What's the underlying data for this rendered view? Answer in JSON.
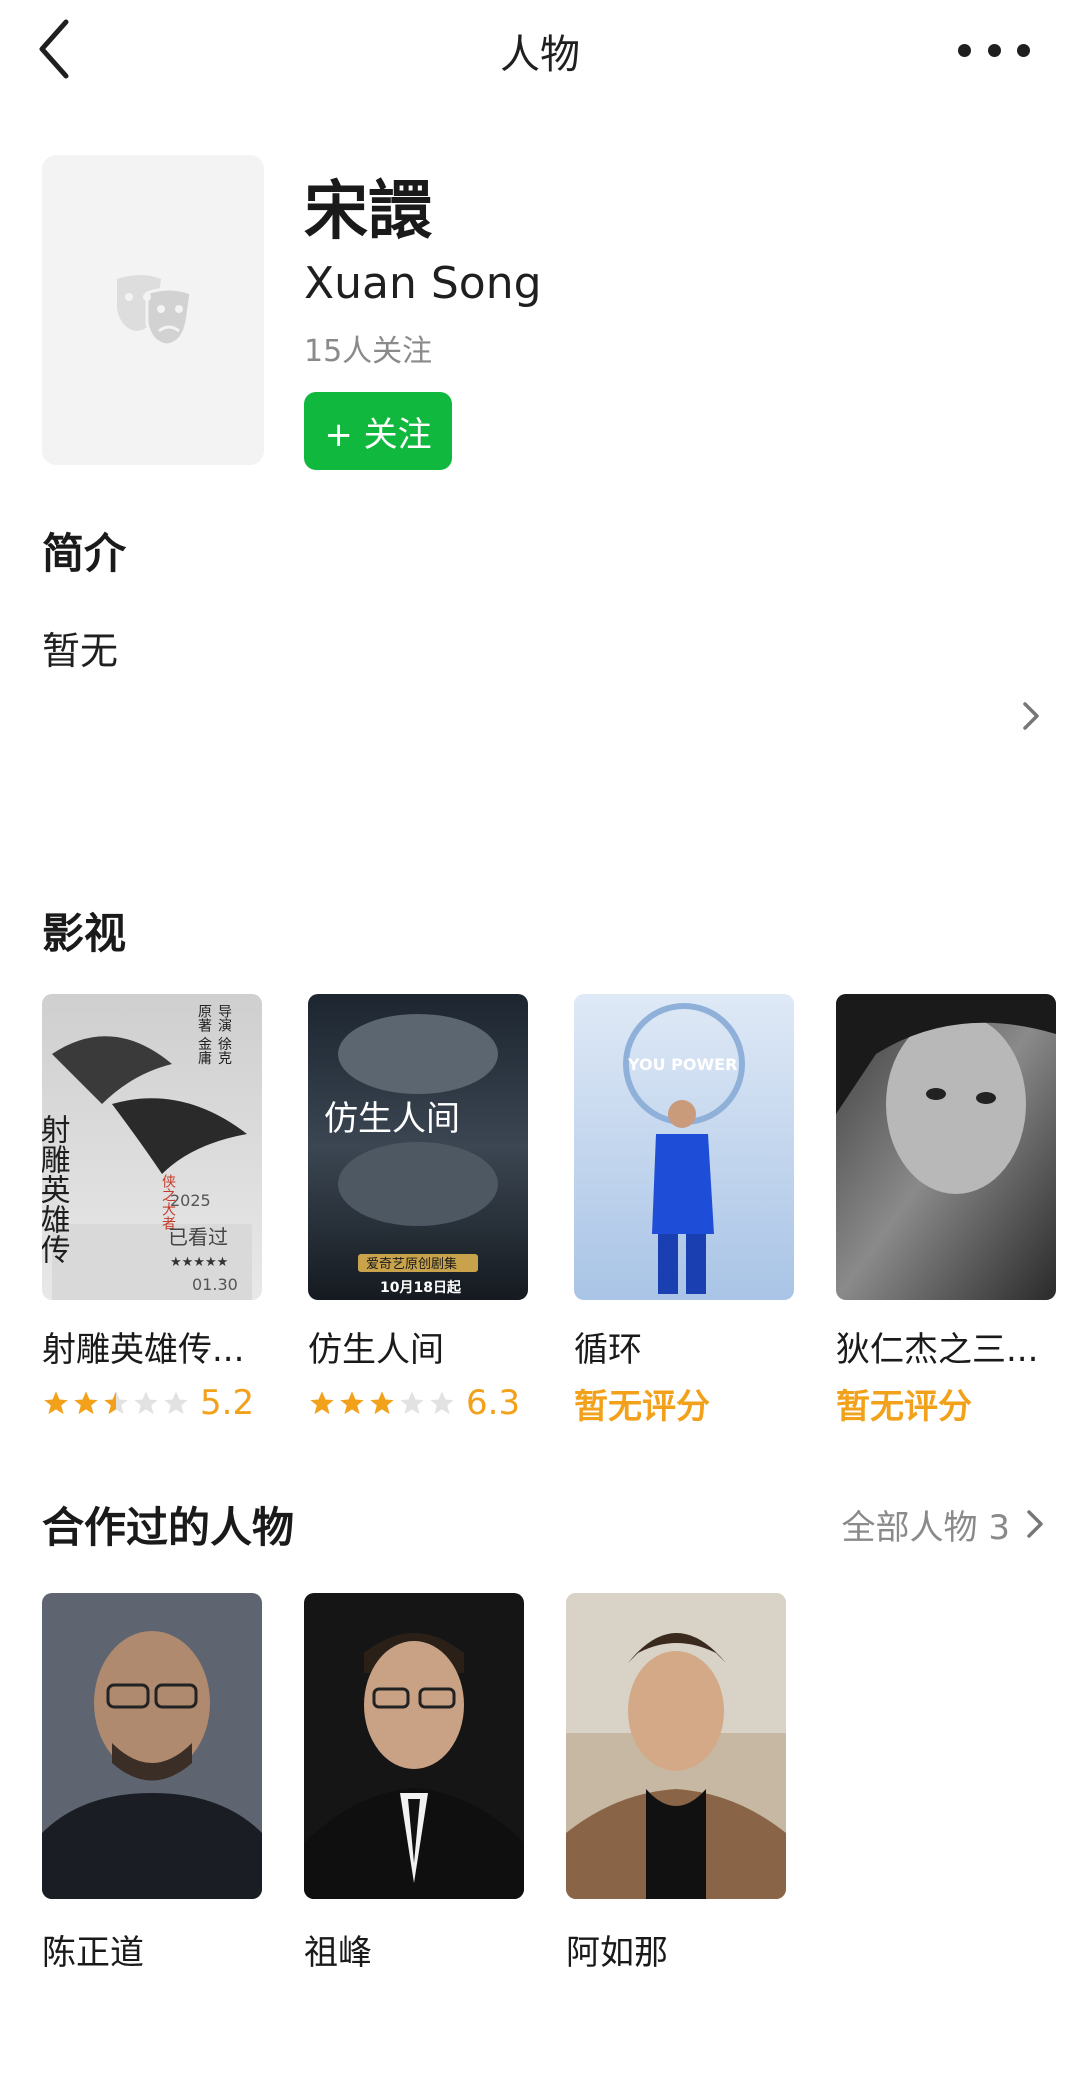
{
  "header": {
    "title": "人物"
  },
  "profile": {
    "name_cn": "宋譞",
    "name_en": "Xuan Song",
    "followers": "15人关注",
    "follow_label": "+ 关注"
  },
  "intro": {
    "title": "简介",
    "text": "暂无"
  },
  "works": {
    "title": "影视",
    "items": [
      {
        "title": "射雕英雄传...",
        "stars": 2.5,
        "score": "5.2",
        "rated": true,
        "poster_text": [
          "射雕英雄传",
          "侠之大者",
          "已看过",
          "2025",
          "01.30",
          "导演 徐克",
          "原著 金庸"
        ]
      },
      {
        "title": "仿生人间",
        "stars": 3,
        "score": "6.3",
        "rated": true,
        "poster_text": [
          "仿生人间",
          "爱奇艺原创剧集",
          "10月18日起"
        ]
      },
      {
        "title": "循环",
        "rated": false,
        "no_rating_label": "暂无评分",
        "poster_text": [
          "YOU POWER"
        ]
      },
      {
        "title": "狄仁杰之三...",
        "rated": false,
        "no_rating_label": "暂无评分"
      }
    ]
  },
  "collaborators": {
    "title": "合作过的人物",
    "all_label": "全部人物 3",
    "people": [
      {
        "name": "陈正道"
      },
      {
        "name": "祖峰"
      },
      {
        "name": "阿如那"
      }
    ]
  },
  "colors": {
    "accent": "#10b93e",
    "rating": "#f2a11a",
    "muted": "#8a8a8a"
  },
  "icons": [
    "back-arrow-icon",
    "more-icon",
    "drama-masks-icon",
    "chevron-right-icon",
    "star-icon"
  ]
}
